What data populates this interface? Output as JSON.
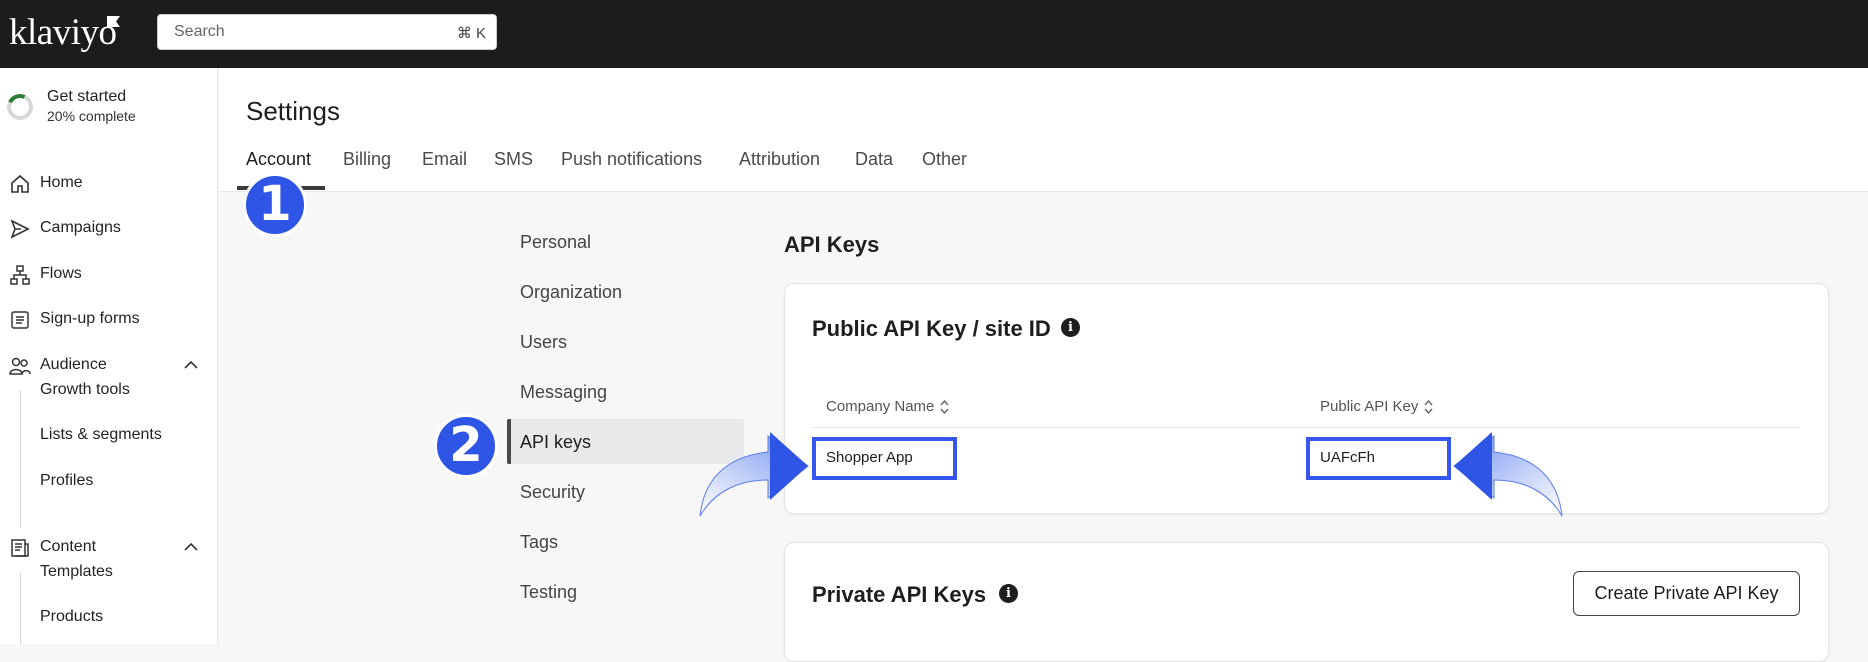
{
  "topbar": {
    "logo": "klaviyo",
    "search_placeholder": "Search",
    "search_shortcut": "⌘ K"
  },
  "sidebar": {
    "get_started": {
      "title": "Get started",
      "progress": "20% complete",
      "progress_fraction": 0.2
    },
    "items": [
      {
        "label": "Home",
        "icon": "home-icon"
      },
      {
        "label": "Campaigns",
        "icon": "send-icon"
      },
      {
        "label": "Flows",
        "icon": "flows-icon"
      },
      {
        "label": "Sign-up forms",
        "icon": "form-icon"
      },
      {
        "label": "Audience",
        "icon": "people-icon",
        "expanded": true
      },
      {
        "label": "Content",
        "icon": "content-icon",
        "expanded": true
      }
    ],
    "audience_children": [
      "Growth tools",
      "Lists & segments",
      "Profiles"
    ],
    "content_children": [
      "Templates",
      "Products"
    ]
  },
  "settings": {
    "title": "Settings",
    "tabs": [
      "Account",
      "Billing",
      "Email",
      "SMS",
      "Push notifications",
      "Attribution",
      "Data",
      "Other"
    ],
    "active_tab": "Account",
    "subnav": [
      "Personal",
      "Organization",
      "Users",
      "Messaging",
      "API keys",
      "Security",
      "Tags",
      "Testing"
    ],
    "active_subnav": "API keys"
  },
  "api_keys": {
    "section_title": "API Keys",
    "public_card": {
      "title": "Public API Key / site ID",
      "columns": [
        "Company Name",
        "Public API Key"
      ],
      "rows": [
        {
          "company": "Shopper App",
          "key": "UAFcFh"
        }
      ]
    },
    "private_card": {
      "title": "Private API Keys",
      "create_button": "Create Private API Key"
    }
  },
  "annotations": {
    "step1": "1",
    "step2": "2",
    "highlight_color": "#3557f0",
    "badge_color": "#2f55e6"
  }
}
